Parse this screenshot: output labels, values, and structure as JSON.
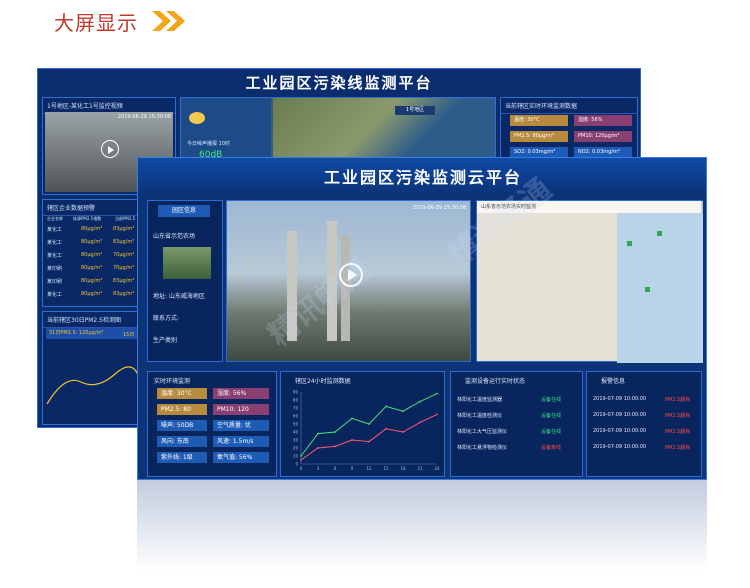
{
  "heading": "大屏显示",
  "watermark": "精讯畅通",
  "back": {
    "title": "工业园区污染线监测平台",
    "video_panel_title": "1号地区-某化工1号监控视频",
    "video_time": "2019-06-29 15:30:08",
    "weather_noise": "今日噪声播报 10时",
    "noise_value": "60dB",
    "map_label": "1号地区",
    "env_panel_title": "当前辖区实时环境监测数据",
    "env": [
      "温度: 30°C",
      "湿度: 56%",
      "PM2.5: 80μg/m³",
      "PM10: 120μg/m³",
      "SO2: 0.03mg/m³",
      "NO2: 0.03mg/m³"
    ],
    "warn_panel_title": "辖区企业数据预警",
    "warn_headers": [
      "企业名称",
      "炼源PM2.5指数",
      "当前PM2.5"
    ],
    "warn_rows": [
      [
        "某化工",
        "80μg/m³",
        "83μg/m³"
      ],
      [
        "某化工",
        "80μg/m³",
        "83μg/m³"
      ],
      [
        "某化工",
        "80μg/m³",
        "70μg/m³"
      ],
      [
        "某印刷",
        "80μg/m³",
        "70μg/m³"
      ],
      [
        "某印刷",
        "80μg/m³",
        "83μg/m³"
      ],
      [
        "某化工",
        "80μg/m³",
        "83μg/m³"
      ]
    ],
    "pm_panel_title": "当前辖区30日PM2.5检测图",
    "pm_day": "31日PM2.5: 120μg/m³",
    "pm_day2": "15日"
  },
  "front": {
    "title": "工业园区污染监测云平台",
    "area_tab": "园区信息",
    "area_name": "山东省示范农场",
    "address": "地址: 山东威海地区",
    "contact": "联系方式:",
    "product": "生产类别",
    "video_time": "2019-06-29 15:30:08",
    "map_note": "山东省示范农场实时监测",
    "env_title": "实时环境监测",
    "env_tags": [
      [
        "温度: 30°C",
        "湿度: 56%"
      ],
      [
        "PM2.5: 80",
        "PM10: 120"
      ],
      [
        "噪声: 50DB",
        "空气质量: 优"
      ],
      [
        "风向: 东南",
        "风速: 1.5m/s"
      ],
      [
        "紫外线: 1级",
        "氧气值: 56%"
      ]
    ],
    "chart_title": "辖区24小时监测数据",
    "device_title": "监测设备运行实时状态",
    "devices": [
      [
        "林阳化工温度监测器",
        "设备在线"
      ],
      [
        "林阳化工温度检测仪",
        "设备在线"
      ],
      [
        "林阳化工大气压监测仪",
        "设备在线"
      ],
      [
        "林阳化工悬浮物检测仪",
        "设备离线"
      ]
    ],
    "alarm_title": "报警信息",
    "alarms": [
      [
        "2019-07-09 10:00:00",
        "PM2.5超标"
      ],
      [
        "2019-07-09 10:00:00",
        "PM2.5超标"
      ],
      [
        "2019-07-09 10:00:00",
        "PM2.5超标"
      ],
      [
        "2019-07-09 10:00:00",
        "PM2.5超标"
      ]
    ]
  },
  "chart_data": {
    "type": "line",
    "x": [
      0,
      3,
      6,
      9,
      12,
      15,
      18,
      21,
      24
    ],
    "ylim": [
      0,
      90
    ],
    "yticks": [
      0,
      10,
      20,
      30,
      40,
      50,
      60,
      70,
      80,
      90
    ],
    "series": [
      {
        "color": "#4be07a",
        "values": [
          10,
          38,
          40,
          57,
          50,
          72,
          66,
          78,
          88
        ]
      },
      {
        "color": "#ff5a6e",
        "values": [
          5,
          20,
          22,
          30,
          28,
          44,
          40,
          52,
          62
        ]
      }
    ]
  },
  "colors": {
    "online": "#38e07a",
    "offline": "#ff4b4b",
    "title": "#ffffff",
    "accent": "#f2a51a"
  }
}
